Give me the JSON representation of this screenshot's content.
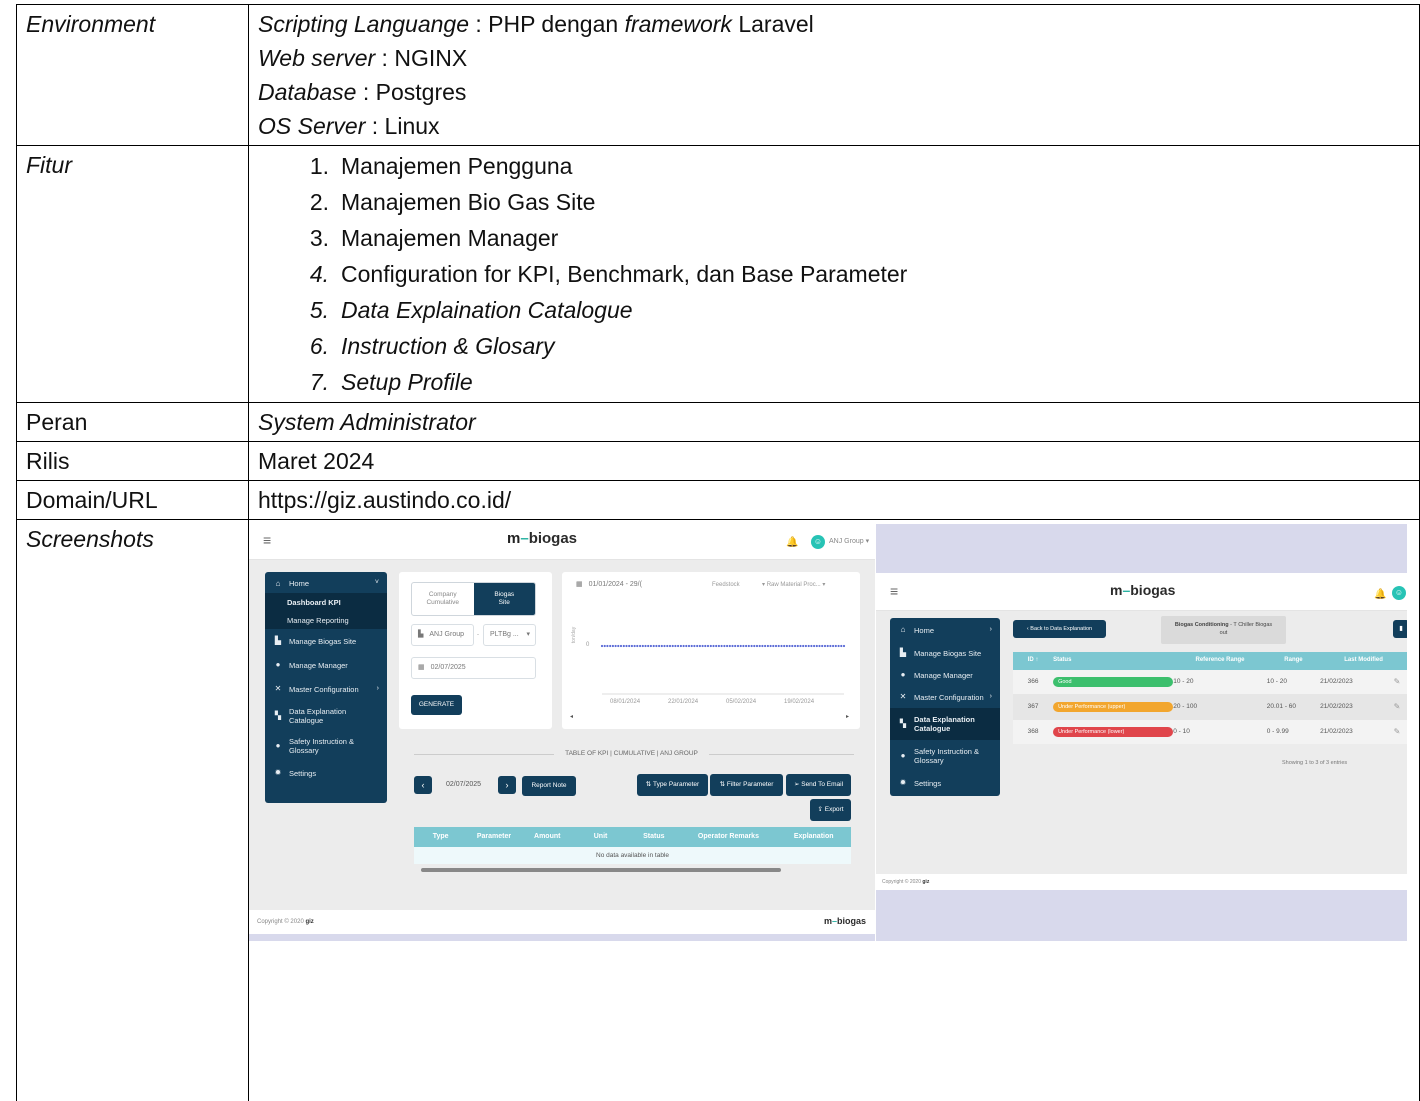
{
  "table": {
    "environment": {
      "label": "Environment",
      "lines": [
        {
          "key": "Scripting Languange",
          "value": " : PHP dengan ",
          "em": "framework",
          "tail": " Laravel"
        },
        {
          "key": "Web server",
          "value": " : NGINX"
        },
        {
          "key": "Database",
          "value": " : Postgres"
        },
        {
          "key": "OS Server",
          "value": " : Linux"
        }
      ]
    },
    "fitur": {
      "label": "Fitur",
      "items": [
        {
          "num": "1.",
          "text": "Manajemen Pengguna"
        },
        {
          "num": "2.",
          "text": "Manajemen Bio Gas Site"
        },
        {
          "num": "3.",
          "text": "Manajemen Manager"
        },
        {
          "num": "4.",
          "text": "Configuration for KPI, Benchmark, dan Base Parameter"
        },
        {
          "num": "5.",
          "text": "Data Explaination Catalogue"
        },
        {
          "num": "6.",
          "text": "Instruction & Glosary"
        },
        {
          "num": "7.",
          "text": "Setup Profile"
        }
      ]
    },
    "peran": {
      "label": "Peran",
      "value": "System Administrator"
    },
    "rilis": {
      "label": "Rilis",
      "value": "Maret 2024"
    },
    "domain": {
      "label": "Domain/URL",
      "value": "https://giz.austindo.co.id/"
    },
    "screenshots": {
      "label": "Screenshots"
    }
  },
  "shot1": {
    "logo_m": "m",
    "logo_word": "biogas",
    "user": "ANJ Group",
    "menu": {
      "home": "Home",
      "dashboard_kpi": "Dashboard KPI",
      "manage_reporting": "Manage Reporting",
      "manage_biogas": "Manage Biogas Site",
      "manage_manager": "Manage Manager",
      "master_config": "Master Configuration",
      "data_expl_1": "Data Explanation",
      "data_expl_2": "Catalogue",
      "safety_1": "Safety Instruction &",
      "safety_2": "Glossary",
      "settings": "Settings"
    },
    "toggle": {
      "left_1": "Company",
      "left_2": "Cumulative",
      "right_1": "Biogas",
      "right_2": "Site"
    },
    "group_select": "ANJ Group",
    "site_select": "PLTBg ...",
    "date_input": "02/07/2025",
    "generate": "GENERATE",
    "chart": {
      "date_range": "01/01/2024 - 29/(",
      "feedstock": "Feedstock",
      "raw_material": "Raw Material Proc...",
      "yunit": "ton/day",
      "zero": "0",
      "ticks": [
        "08/01/2024",
        "22/01/2024",
        "05/02/2024",
        "19/02/2024"
      ]
    },
    "table_title": "TABLE OF KPI | CUMULATIVE | ANJ GROUP",
    "nav_date": "02/07/2025",
    "report_note": "Report Note",
    "type_param": "Type Parameter",
    "filter_param": "Filter Parameter",
    "send_email": "Send To Email",
    "export": "Export",
    "columns": [
      "Type",
      "Parameter",
      "Amount",
      "Unit",
      "Status",
      "Operator Remarks",
      "Explanation"
    ],
    "empty": "No data available in table",
    "copyright": "Copyright © 2020",
    "copyright_brand": "giz"
  },
  "shot2": {
    "logo_m": "m",
    "logo_word": "biogas",
    "menu": {
      "home": "Home",
      "manage_biogas": "Manage Biogas Site",
      "manage_manager": "Manage Manager",
      "master_config": "Master Configuration",
      "data_expl_1": "Data Explanation",
      "data_expl_2": "Catalogue",
      "safety_1": "Safety Instruction &",
      "safety_2": "Glossary",
      "settings": "Settings"
    },
    "back": "Back to Data Explanation",
    "context_bold": "Biogas Conditioning",
    "context_rest": " - T Chiller Biogas",
    "context_line2": "out",
    "columns": [
      "ID",
      "Status",
      "Reference Range",
      "Range",
      "Last Modified"
    ],
    "rows": [
      {
        "id": "366",
        "status": "Good",
        "status_color": "#3cbf6d",
        "ref": "10 - 20",
        "range": "10 - 20",
        "modified": "21/02/2023"
      },
      {
        "id": "367",
        "status": "Under Performance (upper)",
        "status_color": "#f2a62e",
        "ref": "20 - 100",
        "range": "20.01 - 60",
        "modified": "21/02/2023"
      },
      {
        "id": "368",
        "status": "Under Performance (lower)",
        "status_color": "#e0454b",
        "ref": "0 - 10",
        "range": "0 - 9.99",
        "modified": "21/02/2023"
      }
    ],
    "showing": "Showing 1 to 3 of 3 entries",
    "copyright": "Copyright © 2020",
    "copyright_brand": "giz"
  }
}
